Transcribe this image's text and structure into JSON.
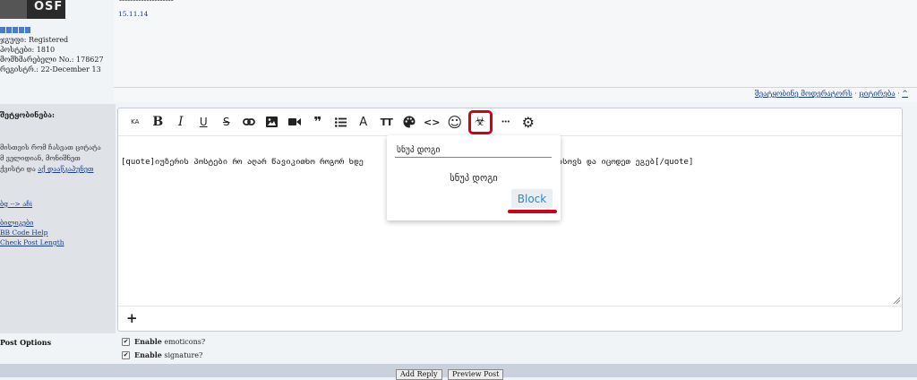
{
  "profile": {
    "avatar_text": "OSF",
    "lines": [
      "ჯგუფი: Registered",
      "პოსტები: 1810",
      "მომხმარებელი No.: 178627",
      "რეგისტრ.: 22-December 13"
    ]
  },
  "post": {
    "dashes": "--------------------",
    "date": "15.11.14"
  },
  "post_actions": {
    "notify_moderators": "შეატყობინე მოდერატორს",
    "quote": "ციტირება",
    "arrow": "^"
  },
  "reply_form": {
    "message_label": "შეტყობინება:",
    "description_lines": [
      "მისთვის რომ ჩასვათ ციტატა",
      "მ ველიდიან, მონიშნეთ",
      "ქვისტი და"
    ],
    "description_link": "აქ დააწკაპუნეთ",
    "side_links": [
      "ბg --> აჩi",
      "ბილიკები",
      "BB Code Help",
      "Check Post Length"
    ]
  },
  "editor": {
    "toolbar": [
      {
        "name": "font-size-button",
        "icon": "font-size-icon",
        "glyph": "KA"
      },
      {
        "name": "bold-button",
        "icon": "bold-icon",
        "glyph": "B"
      },
      {
        "name": "italic-button",
        "icon": "italic-icon",
        "glyph": "I"
      },
      {
        "name": "underline-button",
        "icon": "underline-icon",
        "glyph": "U"
      },
      {
        "name": "strikethrough-button",
        "icon": "strikethrough-icon",
        "glyph": "S"
      },
      {
        "name": "link-button",
        "icon": "link-icon",
        "glyph": "link"
      },
      {
        "name": "image-button",
        "icon": "image-icon",
        "glyph": "image"
      },
      {
        "name": "video-button",
        "icon": "video-icon",
        "glyph": "video"
      },
      {
        "name": "quote-button",
        "icon": "quote-icon",
        "glyph": "❞"
      },
      {
        "name": "list-button",
        "icon": "list-icon",
        "glyph": "list"
      },
      {
        "name": "text-color-button",
        "icon": "text-color-icon",
        "glyph": "A"
      },
      {
        "name": "text-size-button",
        "icon": "text-size-icon",
        "glyph": "TT"
      },
      {
        "name": "palette-button",
        "icon": "palette-icon",
        "glyph": "palette"
      },
      {
        "name": "code-button",
        "icon": "code-icon",
        "glyph": "<>"
      },
      {
        "name": "emoji-button",
        "icon": "emoji-icon",
        "glyph": "☺"
      },
      {
        "name": "spoiler-button",
        "icon": "biohazard-icon",
        "glyph": "☣"
      },
      {
        "name": "more-button",
        "icon": "more-icon",
        "glyph": "•••"
      },
      {
        "name": "settings-button",
        "icon": "gear-icon",
        "glyph": "⚙"
      }
    ],
    "content": "[quote]იუზერის პოსტები რო აღარ წავიკითხო როგორ ხდე                        მარა როგორ არ მახსოვს და იცოდეთ ეგებ[/quote]",
    "add_glyph": "+"
  },
  "spoiler_popup": {
    "input_value": "სნუპ დოგი",
    "preview_text": "სნუპ დოგი",
    "block_label": "Block"
  },
  "post_options": {
    "label": "Post Options",
    "options": [
      {
        "bold": "Enable",
        "rest": " emoticons?",
        "checked": "✔"
      },
      {
        "bold": "Enable",
        "rest": " signature?",
        "checked": "✔"
      }
    ]
  },
  "buttons": {
    "add_reply": "Add Reply",
    "preview": "Preview Post"
  },
  "colors": {
    "highlight_red": "#d0021b",
    "link_blue": "#1a3a8a",
    "block_blue": "#2b87c9"
  }
}
